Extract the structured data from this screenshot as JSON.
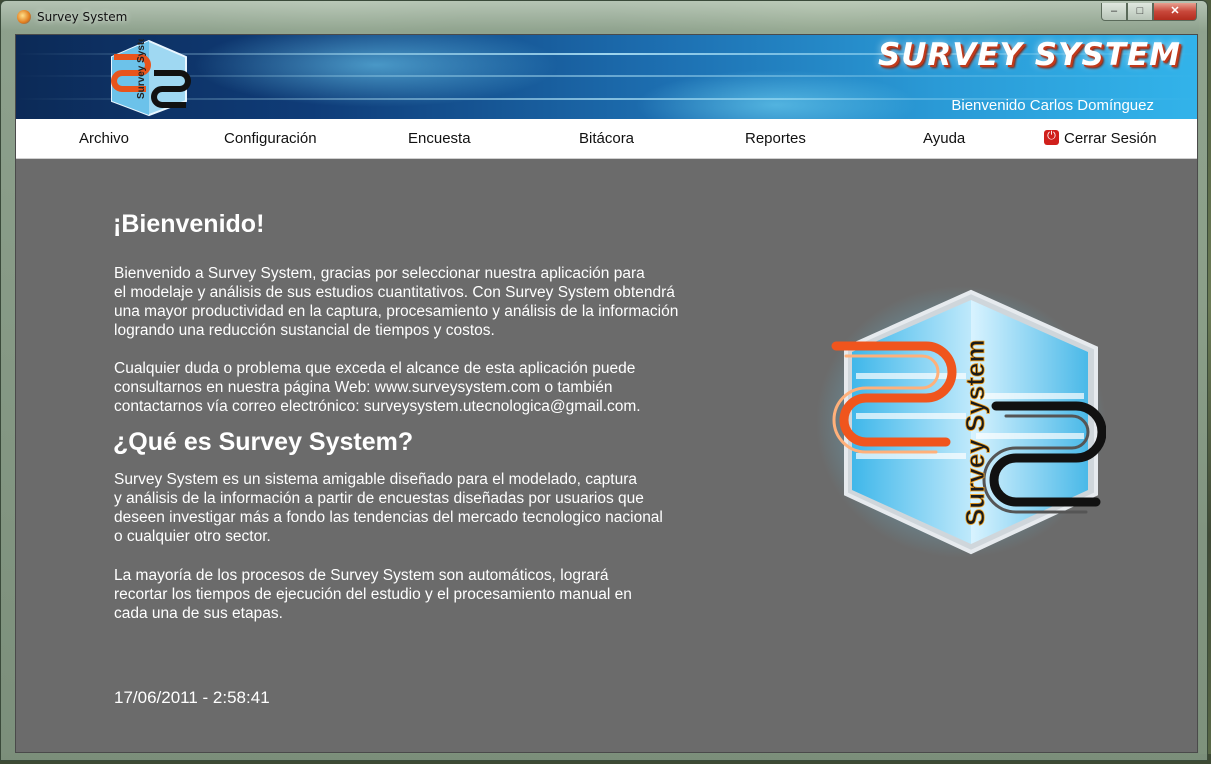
{
  "window": {
    "title": "Survey System",
    "controls": {
      "minimize": "–",
      "maximize": "□",
      "close": "✕"
    }
  },
  "header": {
    "brand": "SURVEY SYSTEM",
    "welcome": "Bienvenido Carlos Domínguez",
    "logo_icon": "survey-system-logo-icon"
  },
  "menu": {
    "items": [
      {
        "label": "Archivo"
      },
      {
        "label": "Configuración"
      },
      {
        "label": "Encuesta"
      },
      {
        "label": "Bitácora"
      },
      {
        "label": "Reportes"
      },
      {
        "label": "Ayuda"
      }
    ],
    "logout": {
      "label": "Cerrar Sesión",
      "icon": "power-icon",
      "icon_color": "#d0201c"
    }
  },
  "main": {
    "welcome_heading": "¡Bienvenido!",
    "p1": "     Bienvenido a Survey System, gracias por seleccionar nuestra aplicación para\nel modelaje y análisis de sus estudios cuantitativos. Con Survey System obtendrá\nuna mayor productividad en la captura, procesamiento y análisis de la información\nlogrando una reducción sustancial de tiempos y costos.",
    "p2": "     Cualquier duda o problema que exceda el alcance de esta aplicación puede\nconsultarnos en nuestra página Web: www.surveysystem.com o también\ncontactarnos vía correo electrónico: surveysystem.utecnologica@gmail.com.",
    "about_heading": "¿Qué es Survey System?",
    "p3": "      Survey System es un sistema amigable diseñado para el modelado, captura\ny análisis de la información a partir de encuestas diseñadas por usuarios que\ndeseen investigar más a fondo las tendencias  del mercado tecnologico nacional\no cualquier otro sector.",
    "p4": "      La mayoría de los procesos de Survey System son automáticos, logrará\nrecortar los tiempos de ejecución del estudio y el procesamiento manual en\ncada una de sus etapas.",
    "datetime": "17/06/2011 - 2:58:41",
    "logo_text": "Survey System"
  },
  "colors": {
    "content_bg": "#6b6b6b",
    "accent_orange": "#e8541c",
    "accent_blue": "#2a9ad6"
  }
}
